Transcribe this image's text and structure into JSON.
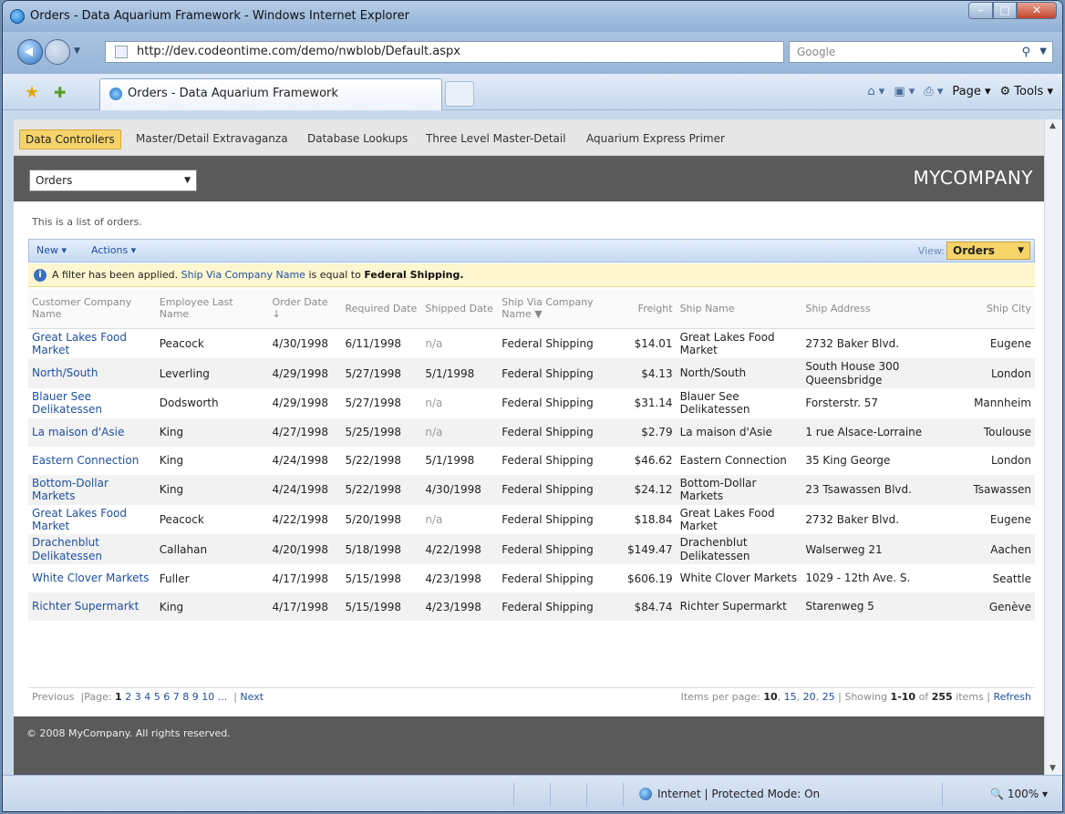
{
  "window": {
    "title": "Orders - Data Aquarium Framework - Windows Internet Explorer"
  },
  "address_bar": {
    "url": "http://dev.codeontime.com/demo/nwblob/Default.aspx",
    "search_placeholder": "Google"
  },
  "tab": {
    "title": "Orders - Data Aquarium Framework"
  },
  "command_bar": {
    "page_label": "Page",
    "tools_label": "Tools"
  },
  "menu": {
    "items": [
      "Data Controllers",
      "Master/Detail Extravaganza",
      "Database Lookups",
      "Three Level Master-Detail",
      "Aquarium Express Primer"
    ],
    "active_index": 0
  },
  "header": {
    "controller_select": "Orders",
    "brand": "MYCOMPANY"
  },
  "description": "This is a list of orders.",
  "action_bar": {
    "new_label": "New",
    "actions_label": "Actions",
    "view_label": "View:",
    "view_value": "Orders"
  },
  "filter": {
    "prefix": "A filter has been applied.",
    "field": "Ship Via Company Name",
    "middle": "is equal to",
    "value": "Federal Shipping."
  },
  "grid": {
    "columns": [
      "Customer Company Name",
      "Employee Last Name",
      "Order Date",
      "Required Date",
      "Shipped Date",
      "Ship Via Company Name",
      "Freight",
      "Ship Name",
      "Ship Address",
      "Ship City"
    ],
    "rows": [
      [
        "Great Lakes Food Market",
        "Peacock",
        "4/30/1998",
        "6/11/1998",
        "n/a",
        "Federal Shipping",
        "$14.01",
        "Great Lakes Food Market",
        "2732 Baker Blvd.",
        "Eugene"
      ],
      [
        "North/South",
        "Leverling",
        "4/29/1998",
        "5/27/1998",
        "5/1/1998",
        "Federal Shipping",
        "$4.13",
        "North/South",
        "South House 300 Queensbridge",
        "London"
      ],
      [
        "Blauer See Delikatessen",
        "Dodsworth",
        "4/29/1998",
        "5/27/1998",
        "n/a",
        "Federal Shipping",
        "$31.14",
        "Blauer See Delikatessen",
        "Forsterstr. 57",
        "Mannheim"
      ],
      [
        "La maison d'Asie",
        "King",
        "4/27/1998",
        "5/25/1998",
        "n/a",
        "Federal Shipping",
        "$2.79",
        "La maison d'Asie",
        "1 rue Alsace-Lorraine",
        "Toulouse"
      ],
      [
        "Eastern Connection",
        "King",
        "4/24/1998",
        "5/22/1998",
        "5/1/1998",
        "Federal Shipping",
        "$46.62",
        "Eastern Connection",
        "35 King George",
        "London"
      ],
      [
        "Bottom-Dollar Markets",
        "King",
        "4/24/1998",
        "5/22/1998",
        "4/30/1998",
        "Federal Shipping",
        "$24.12",
        "Bottom-Dollar Markets",
        "23 Tsawassen Blvd.",
        "Tsawassen"
      ],
      [
        "Great Lakes Food Market",
        "Peacock",
        "4/22/1998",
        "5/20/1998",
        "n/a",
        "Federal Shipping",
        "$18.84",
        "Great Lakes Food Market",
        "2732 Baker Blvd.",
        "Eugene"
      ],
      [
        "Drachenblut Delikatessen",
        "Callahan",
        "4/20/1998",
        "5/18/1998",
        "4/22/1998",
        "Federal Shipping",
        "$149.47",
        "Drachenblut Delikatessen",
        "Walserweg 21",
        "Aachen"
      ],
      [
        "White Clover Markets",
        "Fuller",
        "4/17/1998",
        "5/15/1998",
        "4/23/1998",
        "Federal Shipping",
        "$606.19",
        "White Clover Markets",
        "1029 - 12th Ave. S.",
        "Seattle"
      ],
      [
        "Richter Supermarkt",
        "King",
        "4/17/1998",
        "5/15/1998",
        "4/23/1998",
        "Federal Shipping",
        "$84.74",
        "Richter Supermarkt",
        "Starenweg 5",
        "Genève"
      ]
    ]
  },
  "pager": {
    "previous": "Previous",
    "page_label": "Page:",
    "current_page": "1",
    "pages": [
      "2",
      "3",
      "4",
      "5",
      "6",
      "7",
      "8",
      "9",
      "10",
      "..."
    ],
    "next": "Next",
    "items_per_page_label": "Items per page:",
    "items_current": "10",
    "items_options": [
      "15",
      "20",
      "25"
    ],
    "showing_label": "Showing",
    "showing_range": "1-10",
    "of_label": "of",
    "total": "255",
    "items_label": "items",
    "refresh": "Refresh"
  },
  "footer": {
    "copyright": "© 2008 MyCompany. All rights reserved."
  },
  "status_bar": {
    "zone": "Internet | Protected Mode: On",
    "zoom": "100%"
  }
}
